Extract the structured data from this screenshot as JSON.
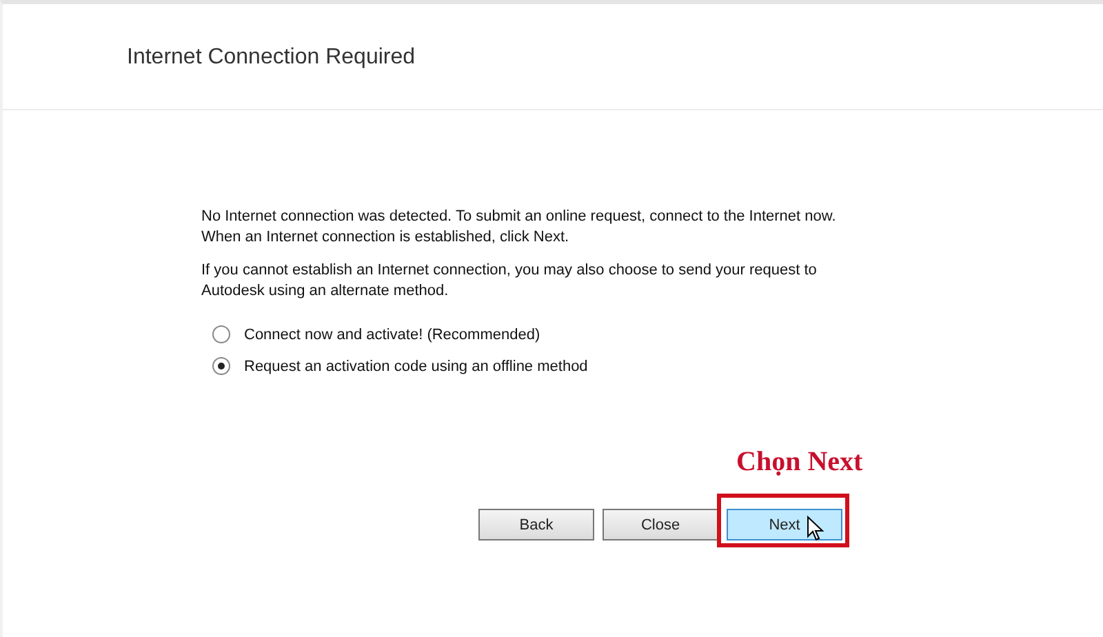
{
  "dialog": {
    "title": "Internet Connection Required",
    "paragraphs": [
      "No Internet connection was detected. To submit an online request, connect to the Internet now. When an Internet connection is established, click Next.",
      "If you cannot establish an Internet connection, you may also choose to send your request to Autodesk using an alternate method."
    ],
    "options": [
      {
        "label": "Connect now and activate! (Recommended)",
        "selected": false
      },
      {
        "label": "Request an activation code using an offline method",
        "selected": true
      }
    ],
    "buttons": [
      {
        "label": "Back",
        "highlighted": false
      },
      {
        "label": "Close",
        "highlighted": false
      },
      {
        "label": "Next",
        "highlighted": true
      }
    ]
  },
  "annotation": {
    "text": "Chọn Next"
  }
}
